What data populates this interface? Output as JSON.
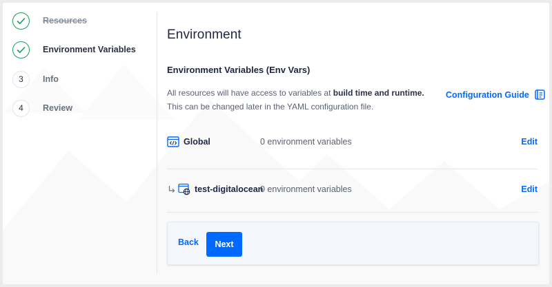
{
  "steps": [
    {
      "number": "",
      "label": "Resources",
      "state": "done-struck"
    },
    {
      "number": "",
      "label": "Environment Variables",
      "state": "done"
    },
    {
      "number": "3",
      "label": "Info",
      "state": "todo"
    },
    {
      "number": "4",
      "label": "Review",
      "state": "todo"
    }
  ],
  "main": {
    "title": "Environment",
    "subtitle": "Environment Variables (Env Vars)",
    "desc_pre": "All resources will have access to variables at ",
    "desc_bold": "build time and runtime.",
    "desc_line2": "This can be changed later in the YAML configuration file.",
    "config_guide_label": "Configuration Guide"
  },
  "rows": [
    {
      "name": "Global",
      "count": "0 environment variables",
      "edit_label": "Edit",
      "icon": "code-window-icon"
    },
    {
      "name": "test-digitalocean",
      "count": "0 environment variables",
      "edit_label": "Edit",
      "icon": "web-component-icon"
    }
  ],
  "footer": {
    "back_label": "Back",
    "next_label": "Next"
  },
  "colors": {
    "accent": "#0069ff",
    "success": "#15a05c",
    "text_primary": "#1e2540"
  }
}
